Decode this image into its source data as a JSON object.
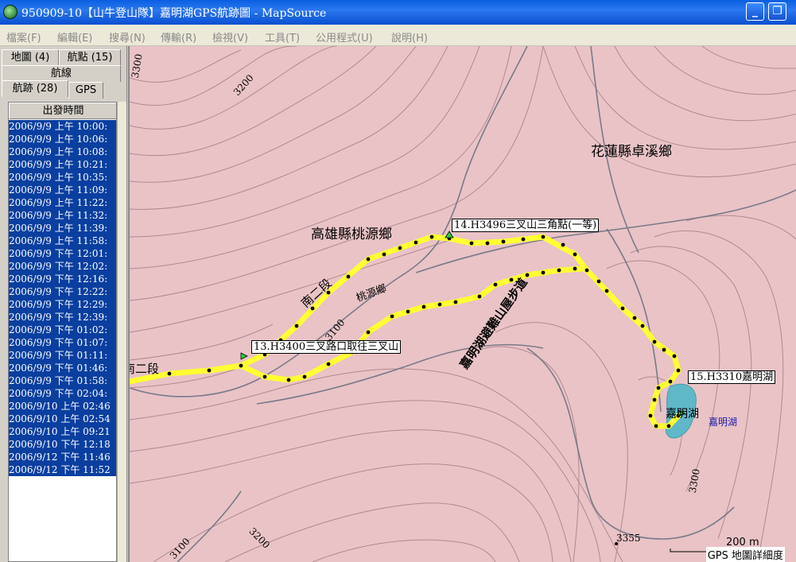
{
  "window": {
    "title": "950909-10【山牛登山隊】嘉明湖GPS航跡圖 - MapSource"
  },
  "menu": [
    "檔案(F)",
    "編輯(E)",
    "搜尋(N)",
    "傳輸(R)",
    "檢視(V)",
    "工具(T)",
    "公用程式(U)",
    "說明(H)"
  ],
  "tabs": {
    "maps": "地圖 (4)",
    "waypoints": "航點 (15)",
    "routes": "航線",
    "tracks": "航跡 (28)",
    "gps": "GPS"
  },
  "track_list": {
    "header": "出發時間",
    "rows": [
      "2006/9/9 上午 10:00:",
      "2006/9/9 上午 10:06:",
      "2006/9/9 上午 10:08:",
      "2006/9/9 上午 10:21:",
      "2006/9/9 上午 10:35:",
      "2006/9/9 上午 11:09:",
      "2006/9/9 上午 11:22:",
      "2006/9/9 上午 11:32:",
      "2006/9/9 上午 11:39:",
      "2006/9/9 上午 11:58:",
      "2006/9/9 下午 12:01:",
      "2006/9/9 下午 12:02:",
      "2006/9/9 下午 12:16:",
      "2006/9/9 下午 12:22:",
      "2006/9/9 下午 12:29:",
      "2006/9/9 下午 12:39:",
      "2006/9/9 下午 01:02:",
      "2006/9/9 下午 01:07:",
      "2006/9/9 下午 01:11:",
      "2006/9/9 下午 01:46:",
      "2006/9/9 下午 01:58:",
      "2006/9/9 下午 02:04:",
      "2006/9/10 上午 02:46",
      "2006/9/10 上午 02:54",
      "2006/9/10 上午 09:21",
      "2006/9/10 下午 12:18",
      "2006/9/12 下午 11:46",
      "2006/9/12 下午 11:52"
    ]
  },
  "map": {
    "region_labels": [
      "花蓮縣卓溪鄉",
      "高雄縣桃源鄉",
      "桃源鄉",
      "南二段",
      "南二段",
      "嘉明湖避難山屋步道",
      "嘉明湖",
      "嘉明湖"
    ],
    "contours": [
      "3200",
      "3100",
      "3200",
      "3100",
      "3300",
      "3300"
    ],
    "spot_elevation": "3355",
    "waypoints": [
      "13.H3400三叉路口取往三叉山",
      "14.H3496三叉山三角點(一等)",
      "15.H3310嘉明湖"
    ],
    "scale": "200 m",
    "status": "GPS 地圖詳細度",
    "colors": {
      "terrain": "#e9c3c6",
      "contour": "#b08a8f",
      "track": "#ffff33",
      "lake": "#5fb8c8",
      "road": "#7a7a8a"
    }
  }
}
